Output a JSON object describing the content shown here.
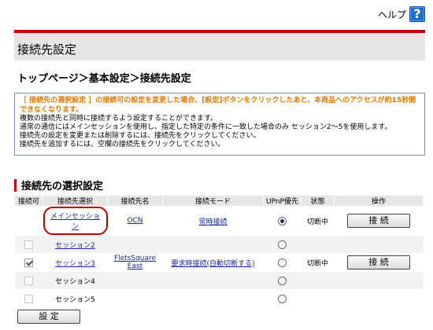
{
  "help": {
    "label": "ヘルプ",
    "icon": "?"
  },
  "page": {
    "title": "接続先設定",
    "breadcrumb": "トップページ＞基本設定＞接続先設定"
  },
  "notice": {
    "warning": "［ 接続先の選択設定 ］の接続可の設定を変更した場合、[設定]ボタンをクリックしたあと、本商品へのアクセスが約15秒間できなくなります。",
    "lines": [
      "複数の接続先と同時に接続するよう設定することができます。",
      "通常の通信にはメインセッションを使用し、指定した特定の条件に一致した場合のみ セッション2〜5を使用します。",
      "接続先の設定を変更または削除するには、接続先をクリックしてください。",
      "接続先を追加するには、空欄の接続先をクリックしてください。"
    ]
  },
  "section": {
    "title": "接続先の選択設定"
  },
  "table": {
    "headers": [
      "接続可",
      "接続先選択",
      "接続先名",
      "接続モード",
      "UPnP優先",
      "状態",
      "操作"
    ],
    "rows": [
      {
        "enable": "none",
        "session": "メインセッション",
        "session_link": true,
        "name": "OCN",
        "mode": "常時接続",
        "upnp": true,
        "status": "切断中",
        "action": "接 続"
      },
      {
        "enable": "disabled",
        "session": "セッション2",
        "session_link": true,
        "name": "",
        "mode": "",
        "upnp": false,
        "status": "",
        "action": ""
      },
      {
        "enable": "checked",
        "session": "セッション3",
        "session_link": true,
        "name": "FletsSquare East",
        "mode": "要求時接続(自動切断する)",
        "upnp": false,
        "status": "切断中",
        "action": "接 続"
      },
      {
        "enable": "disabled",
        "session": "セッション4",
        "session_link": false,
        "name": "",
        "mode": "",
        "upnp": false,
        "status": "",
        "action": ""
      },
      {
        "enable": "disabled",
        "session": "セッション5",
        "session_link": false,
        "name": "",
        "mode": "",
        "upnp": false,
        "status": "",
        "action": ""
      }
    ]
  },
  "footer": {
    "submit_label": "設 定"
  },
  "colors": {
    "accent": "#cc0000",
    "link": "#1a2a9a",
    "warning": "#e07800",
    "band": "#e6e6e6"
  }
}
